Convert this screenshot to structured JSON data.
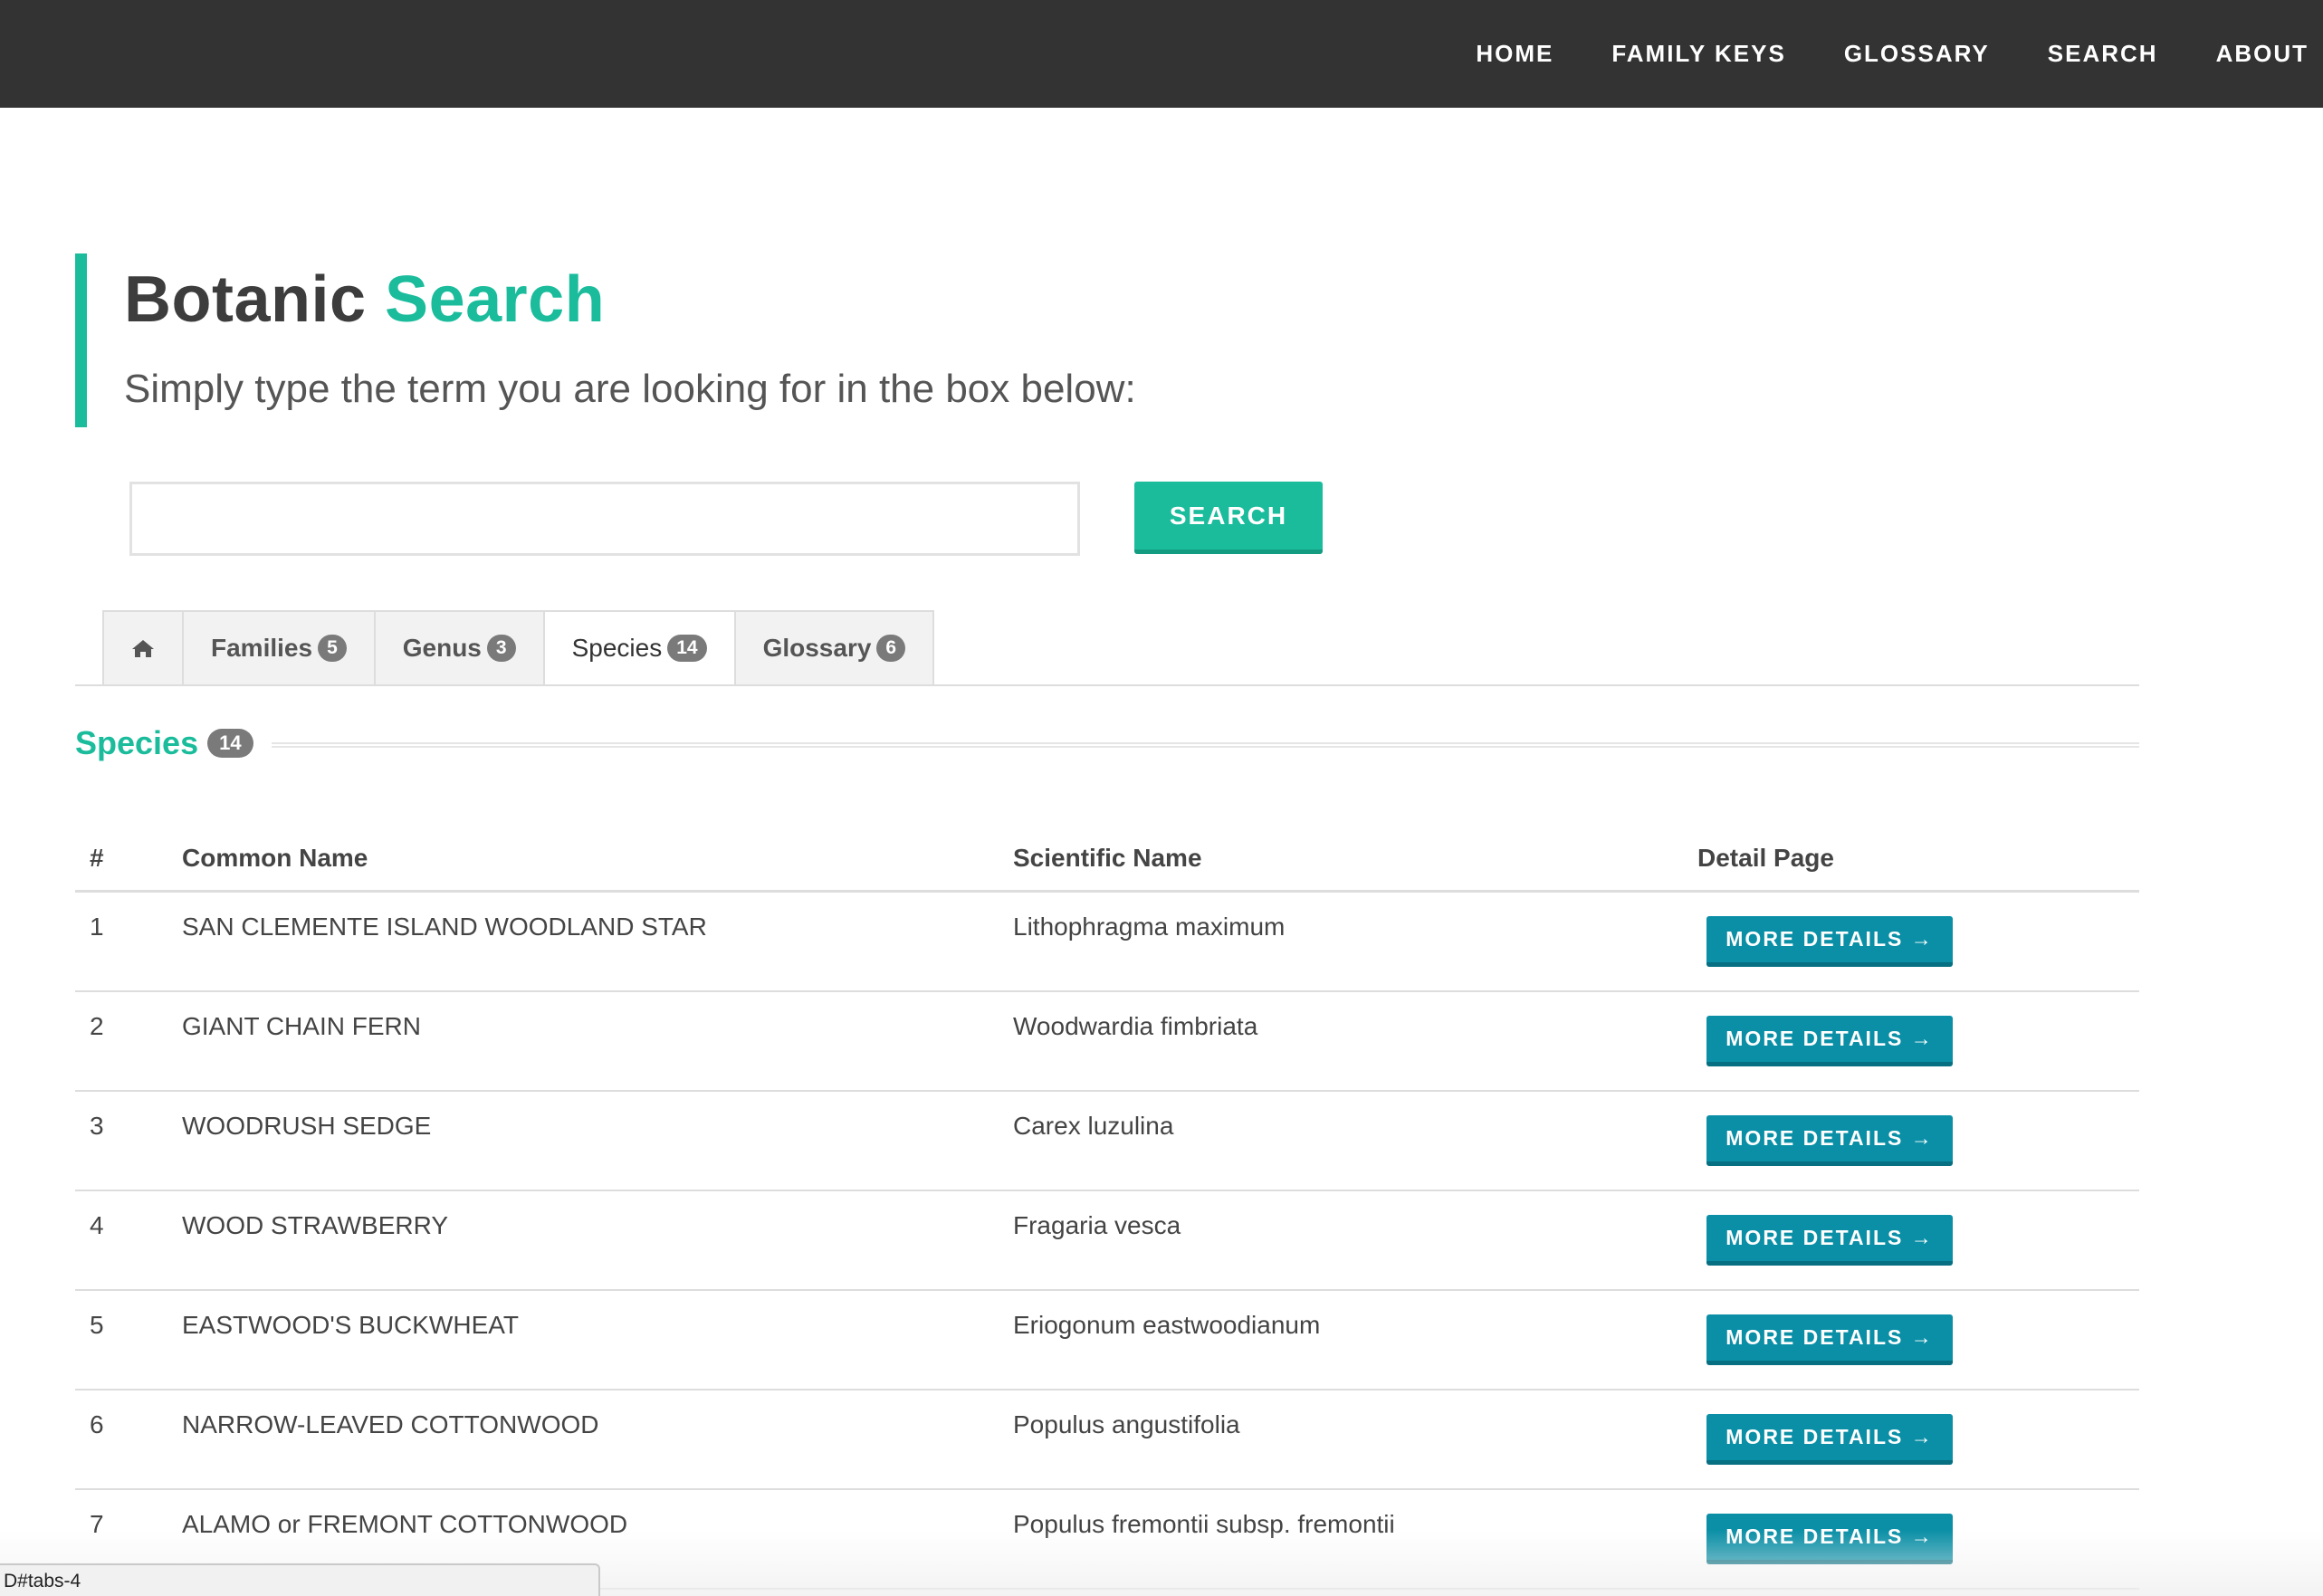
{
  "nav": {
    "items": [
      "HOME",
      "FAMILY KEYS",
      "GLOSSARY",
      "SEARCH",
      "ABOUT"
    ]
  },
  "header": {
    "title_main": "Botanic",
    "title_accent": "Search",
    "subtitle": "Simply type the term you are looking for in the box below:"
  },
  "search": {
    "value": "",
    "placeholder": "",
    "button_label": "SEARCH"
  },
  "tabs": [
    {
      "label": "",
      "icon": "home-icon",
      "count": ""
    },
    {
      "label": "Families",
      "count": "5"
    },
    {
      "label": "Genus",
      "count": "3"
    },
    {
      "label": "Species",
      "count": "14",
      "active": true
    },
    {
      "label": "Glossary",
      "count": "6"
    }
  ],
  "section": {
    "title": "Species",
    "count": "14"
  },
  "table": {
    "columns": [
      "#",
      "Common Name",
      "Scientific Name",
      "Detail Page"
    ],
    "rows": [
      {
        "num": "1",
        "common": "SAN CLEMENTE ISLAND WOODLAND STAR",
        "scientific": "Lithophragma maximum",
        "button": "MORE DETAILS →"
      },
      {
        "num": "2",
        "common": "GIANT CHAIN FERN",
        "scientific": "Woodwardia fimbriata",
        "button": "MORE DETAILS →"
      },
      {
        "num": "3",
        "common": "WOODRUSH SEDGE",
        "scientific": "Carex luzulina",
        "button": "MORE DETAILS →"
      },
      {
        "num": "4",
        "common": "WOOD STRAWBERRY",
        "scientific": "Fragaria vesca",
        "button": "MORE DETAILS →"
      },
      {
        "num": "5",
        "common": "EASTWOOD'S BUCKWHEAT",
        "scientific": "Eriogonum eastwoodianum",
        "button": "MORE DETAILS →"
      },
      {
        "num": "6",
        "common": "NARROW-LEAVED COTTONWOOD",
        "scientific": "Populus angustifolia",
        "button": "MORE DETAILS →"
      },
      {
        "num": "7",
        "common": "ALAMO or FREMONT COTTONWOOD",
        "scientific": "Populus fremontii subsp. fremontii",
        "button": "MORE DETAILS →"
      }
    ]
  },
  "status_bar": {
    "text": "D#tabs-4"
  },
  "colors": {
    "accent": "#1abc9c",
    "button_blue": "#0a8fa6",
    "topbar": "#333333"
  }
}
